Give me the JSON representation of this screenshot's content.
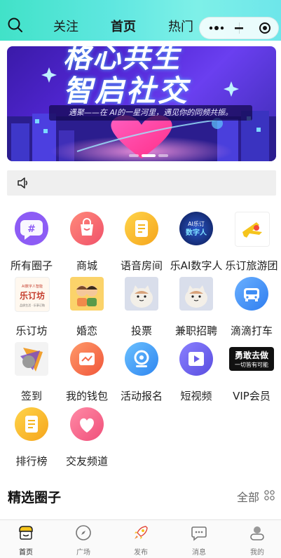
{
  "header": {
    "tabs": [
      {
        "label": "关注",
        "active": false
      },
      {
        "label": "首页",
        "active": true
      },
      {
        "label": "热门",
        "active": false
      }
    ],
    "icons": {
      "search": "search-icon",
      "more": "more-dots-icon",
      "minimize": "minimize-icon",
      "close": "close-target-icon"
    }
  },
  "banner": {
    "title_line1": "格心共生",
    "title_line2": "智启社交",
    "subtitle": "遇聚——在 AI的一星河里，遇见你的同频共振。",
    "page_count": 3,
    "active_index": 1
  },
  "notice": {
    "icon": "speaker-icon",
    "text": ""
  },
  "grid": [
    {
      "label": "所有圈子",
      "icon": "hashtag-icon",
      "color": "#8d5cf5"
    },
    {
      "label": "商城",
      "icon": "shopping-bag-icon",
      "color": "#f0616a"
    },
    {
      "label": "语音房间",
      "icon": "voice-room-icon",
      "color": "#f5b41c"
    },
    {
      "label": "乐AI数字人",
      "icon": "ai-digital-human-icon",
      "color": "#1a2a6b",
      "icon_text": "AI乐订\n数字人"
    },
    {
      "label": "乐订旅游团",
      "icon": "travel-group-icon",
      "color": "#f5c41c"
    },
    {
      "label": "乐订坊",
      "icon": "ledingfang-logo-icon",
      "color": "#c43a2a",
      "icon_text": "乐订坊"
    },
    {
      "label": "婚恋",
      "icon": "couple-icon",
      "color": "#f2a83a"
    },
    {
      "label": "投票",
      "icon": "cat-vote-icon",
      "color": "#cfd6e8"
    },
    {
      "label": "兼职招聘",
      "icon": "cat-job-icon",
      "color": "#cfd6e8"
    },
    {
      "label": "滴滴打车",
      "icon": "taxi-icon",
      "color": "#3d8df5"
    },
    {
      "label": "签到",
      "icon": "checkin-icon",
      "color": "#7a4ec2"
    },
    {
      "label": "我的钱包",
      "icon": "wallet-icon",
      "color": "#f56a4a"
    },
    {
      "label": "活动报名",
      "icon": "activity-signup-icon",
      "color": "#3a9af0"
    },
    {
      "label": "短视频",
      "icon": "short-video-icon",
      "color": "#6a5ee8"
    },
    {
      "label": "VIP会员",
      "icon": "vip-icon",
      "color": "#111111",
      "icon_text": "勇敢去做\n一切皆有可能"
    },
    {
      "label": "排行榜",
      "icon": "ranking-icon",
      "color": "#f5b41c"
    },
    {
      "label": "交友频道",
      "icon": "heart-icon",
      "color": "#f26a8a"
    }
  ],
  "section": {
    "title": "精选圈子",
    "see_all": "全部",
    "grid_icon": "grid-icon"
  },
  "tabbar": [
    {
      "label": "首页",
      "icon": "home-shop-icon",
      "active": true
    },
    {
      "label": "广场",
      "icon": "compass-icon",
      "active": false
    },
    {
      "label": "发布",
      "icon": "rocket-icon",
      "active": false
    },
    {
      "label": "消息",
      "icon": "message-icon",
      "active": false
    },
    {
      "label": "我的",
      "icon": "profile-icon",
      "active": false
    }
  ],
  "colors": {
    "header_start": "#41e2c8",
    "header_end": "#7ef0e8",
    "banner": "#5327d6"
  }
}
